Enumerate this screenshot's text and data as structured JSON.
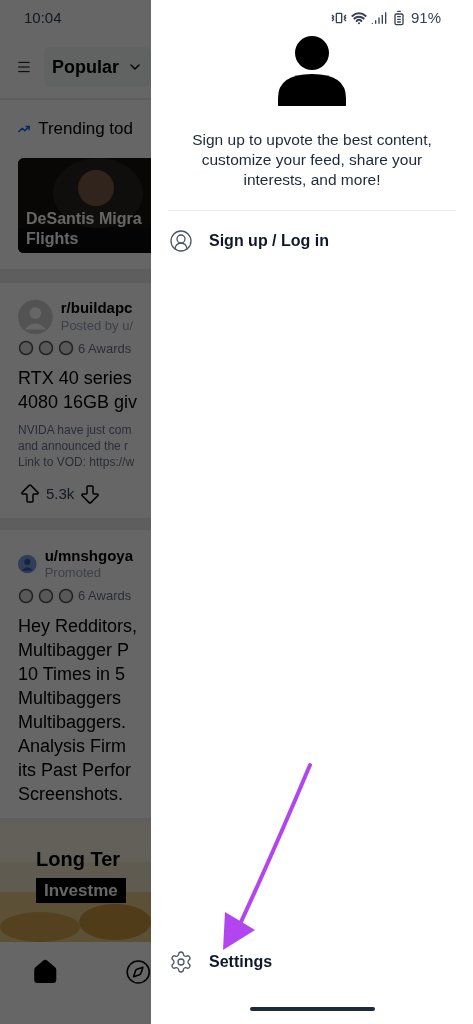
{
  "status_bar": {
    "time": "10:04",
    "battery": "91%"
  },
  "feed": {
    "feed_selector": "Popular",
    "trending_title": "Trending tod",
    "trending_card": {
      "title_lines": [
        "DeSantis Migra",
        "Flights"
      ]
    },
    "posts": [
      {
        "community": "r/buildapc",
        "meta": "Posted by u/",
        "awards": "6 Awards",
        "title_lines": [
          "RTX 40 series",
          "4080 16GB giv"
        ],
        "body_lines": [
          "NVIDA have just com",
          "and announced the r",
          "Link to VOD: https://w"
        ],
        "score": "5.3k"
      },
      {
        "community": "u/mnshgoya",
        "meta": "Promoted",
        "awards": "6 Awards",
        "title_lines": [
          "Hey Redditors,",
          "Multibagger P",
          "10 Times in 5",
          "Multibaggers",
          "Multibaggers.",
          "Analysis Firm",
          "its Past Perfor",
          "Screenshots."
        ]
      }
    ],
    "ad_banner": {
      "headline": "Long Ter",
      "tag": "Investme"
    }
  },
  "bottom_nav": [
    {
      "kind": "home",
      "selected": true
    },
    {
      "kind": "explore",
      "selected": false
    }
  ],
  "drawer": {
    "prompt": "Sign up to upvote the best content, customize your feed, share your interests, and more!",
    "items": [
      {
        "kind": "account",
        "label": "Sign up / Log in"
      }
    ],
    "footer_items": [
      {
        "kind": "settings",
        "label": "Settings"
      }
    ]
  }
}
